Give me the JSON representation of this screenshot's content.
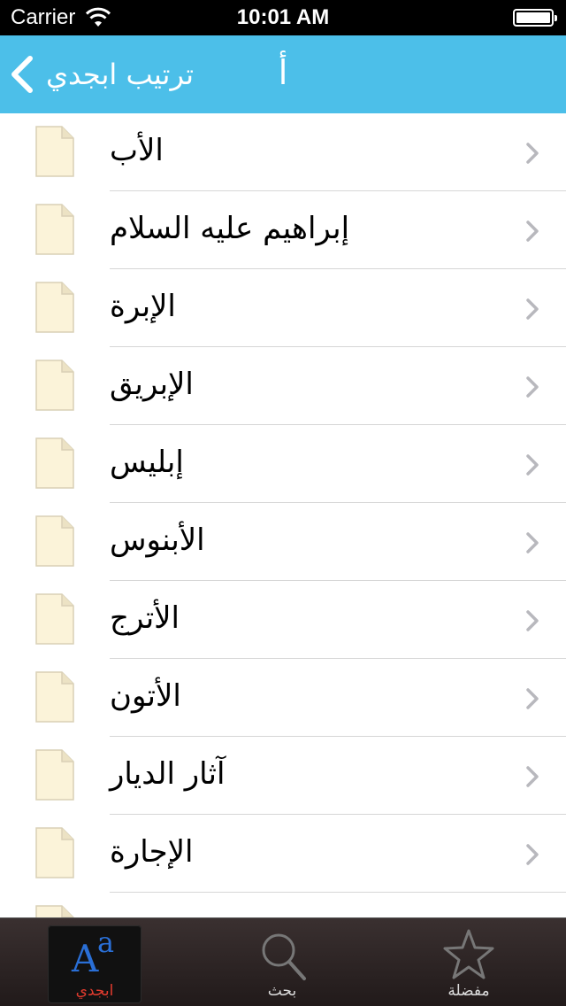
{
  "status_bar": {
    "carrier": "Carrier",
    "time": "10:01 AM"
  },
  "nav": {
    "back_label": "ترتيب ابجدي",
    "title": "أ"
  },
  "list": {
    "items": [
      {
        "label": "الأب"
      },
      {
        "label": "إبراهيم عليه السلام"
      },
      {
        "label": "الإبرة"
      },
      {
        "label": "الإبريق"
      },
      {
        "label": "إبليس"
      },
      {
        "label": "الأبنوس"
      },
      {
        "label": "الأترج"
      },
      {
        "label": "الأتون"
      },
      {
        "label": "آثار الديار"
      },
      {
        "label": "الإجارة"
      },
      {
        "label": ""
      }
    ]
  },
  "tabs": [
    {
      "label": "ابجدي",
      "icon": "alphabet-icon",
      "selected": true
    },
    {
      "label": "بحث",
      "icon": "search-icon",
      "selected": false
    },
    {
      "label": "مفضلة",
      "icon": "star-icon",
      "selected": false
    }
  ],
  "colors": {
    "nav_bar": "#4cbfe9",
    "selected_tab_label": "#e23b2e",
    "tab_bar": "#2a2222"
  }
}
